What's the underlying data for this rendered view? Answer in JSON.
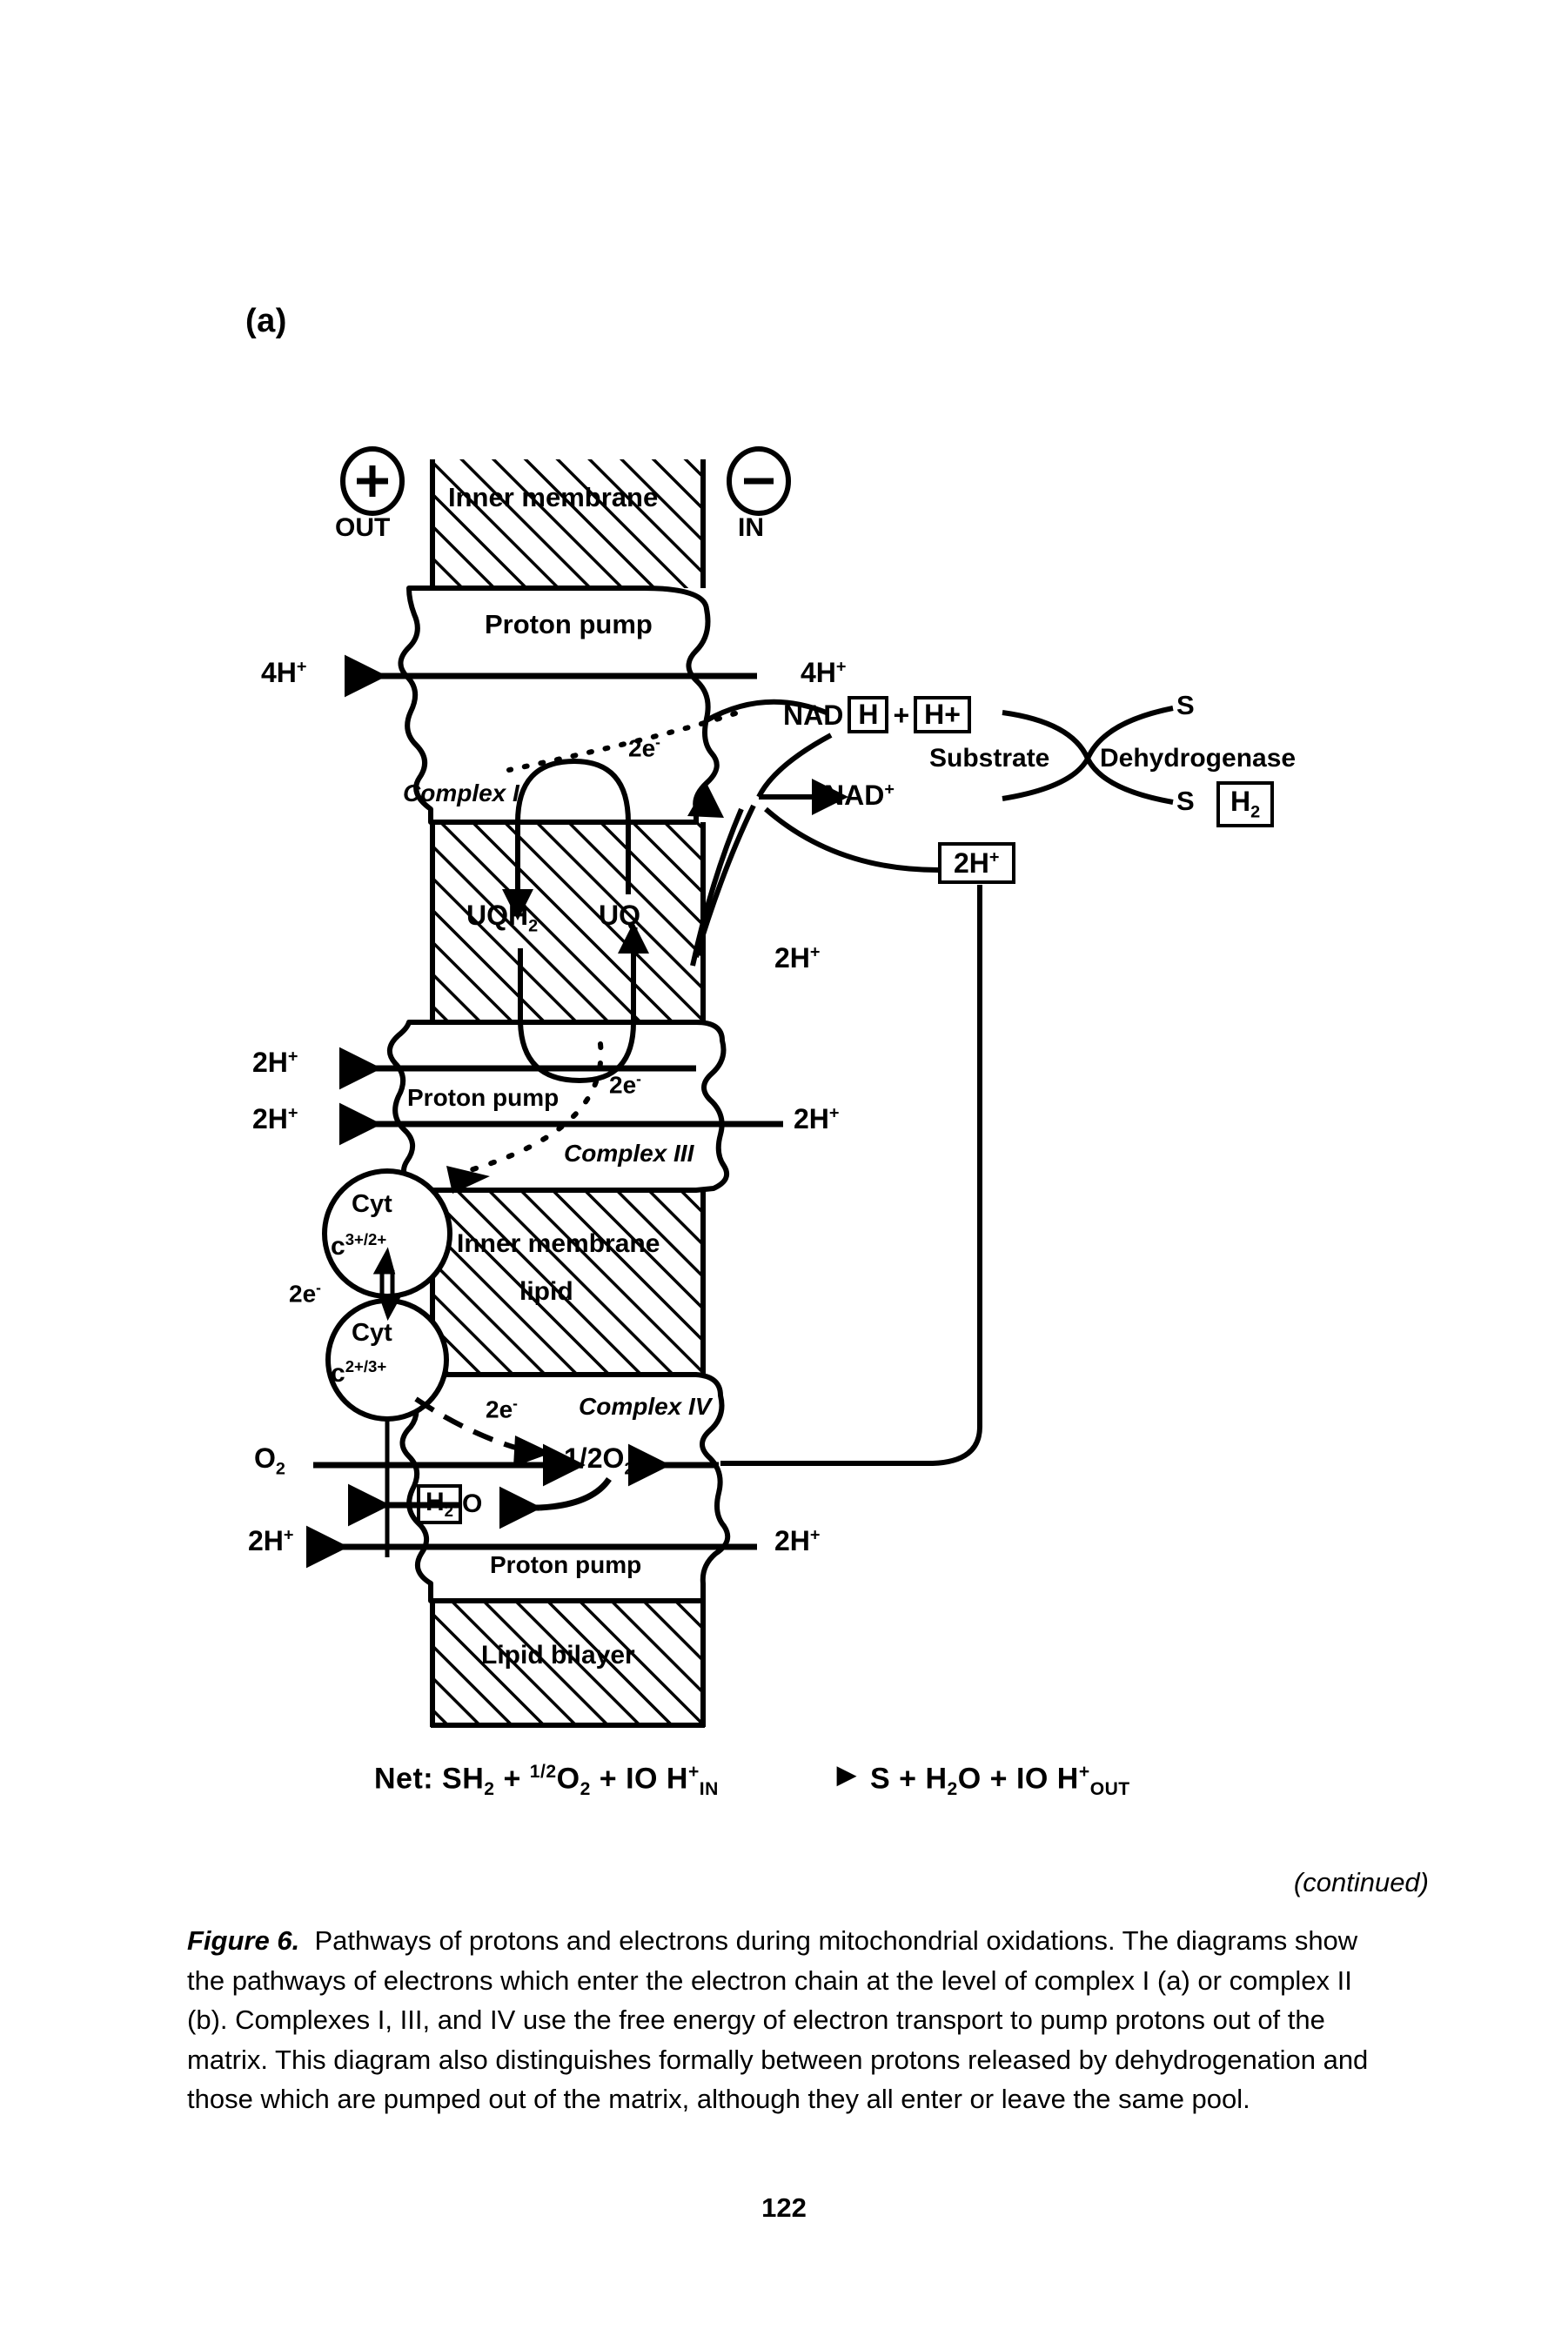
{
  "panel": {
    "label": "(a)"
  },
  "diagram": {
    "polarity": {
      "out_sign": "+",
      "out_label": "OUT",
      "in_sign": "−",
      "in_label": "IN"
    },
    "membrane_labels": {
      "inner_membrane_top": "Inner membrane",
      "inner_membrane_mid_line1": "Inner membrane",
      "inner_membrane_mid_line2": "lipid",
      "lipid_bilayer": "Lipid bilayer"
    },
    "pumps": [
      {
        "name": "proton-pump-complex-I",
        "label": "Proton pump"
      },
      {
        "name": "proton-pump-complex-III",
        "label": "Proton pump"
      },
      {
        "name": "proton-pump-complex-IV",
        "label": "Proton pump"
      }
    ],
    "complexes": [
      {
        "name": "complex-I",
        "label": "Complex I"
      },
      {
        "name": "complex-III",
        "label": "Complex III"
      },
      {
        "name": "complex-IV",
        "label": "Complex IV"
      }
    ],
    "quinone": {
      "reduced": "UQH",
      "reduced_sub": "2",
      "oxidized": "UQ"
    },
    "cytochromes": [
      {
        "name": "cyt-c-3plus-2plus",
        "line1": "Cyt",
        "c": "c",
        "state": "3+/2+"
      },
      {
        "name": "cyt-c-2plus-3plus",
        "line1": "Cyt",
        "c": "c",
        "state": "2+/3+"
      }
    ],
    "proton_flux": {
      "complexI_out": "4H",
      "complexI_in": "4H",
      "complexIII_out_top": "2H",
      "complexIII_out_bottom": "2H",
      "complexIII_in": "2H",
      "complexIV_out": "2H",
      "complexIV_in": "2H",
      "charge": "+"
    },
    "electrons": {
      "e1": "2e",
      "e2": "2e",
      "e3": "2e",
      "e4": "2e",
      "minus": "-"
    },
    "nad": {
      "reduced_prefix": "NAD",
      "reduced_box": "H",
      "plus_sign": "+",
      "proton_box": "H+",
      "oxidized": "NAD",
      "oxidized_charge": "+"
    },
    "substrate_cycle": {
      "substrate": "Substrate",
      "dehydrogenase": "Dehydrogenase",
      "s_top": "S",
      "s_bottom": "S",
      "h2_box": "H",
      "h2_box_sub": "2"
    },
    "dehydrogenation_protons": {
      "box_label": "2H",
      "box_charge": "+",
      "free_label": "2H",
      "free_charge": "+"
    },
    "oxygen": {
      "o2": "O",
      "o2_sub": "2",
      "half_o2": "1/2O",
      "half_o2_sub": "2",
      "water_box": "H",
      "water_box_sub": "2",
      "water_o": "O"
    },
    "net_equation": {
      "left": "Net: SH₂ + ¹ᐟ₂O₂ + IO H⁺ᴵᴺ",
      "left_plain": "Net: SH2 + 1/2O2 + IO H+IN",
      "arrow": "▶",
      "right_plain": "S + H2O + IO H+OUT",
      "net_prefix": "Net: SH",
      "net_sh2_sub": "2",
      "net_plus1": "+",
      "net_half": "1/2",
      "net_o": "O",
      "net_o_sub": "2",
      "net_plus2": "+",
      "net_io": "IO H",
      "net_in_sup": "+",
      "net_in_sub": "IN",
      "rhs_s": "S",
      "rhs_plus1": "+",
      "rhs_h2o": "H",
      "rhs_h2o_sub": "2",
      "rhs_h2o_o": "O",
      "rhs_plus2": "+",
      "rhs_io": "IO H",
      "rhs_out_sup": "+",
      "rhs_out_sub": "OUT"
    }
  },
  "caption": {
    "continued": "(continued)",
    "figure_number": "Figure 6.",
    "text": "Pathways of protons and electrons during mitochondrial oxidations. The diagrams show the pathways of electrons which enter the electron chain at the level of complex I (a) or complex II (b). Complexes I, III, and IV use the free energy of electron transport to pump protons out of the matrix. This diagram also distinguishes formally between protons released by dehydrogenation and those which are pumped out of the matrix, although they all enter or leave the same pool."
  },
  "page_number": "122",
  "colors": {
    "ink": "#000000",
    "paper": "#ffffff"
  }
}
